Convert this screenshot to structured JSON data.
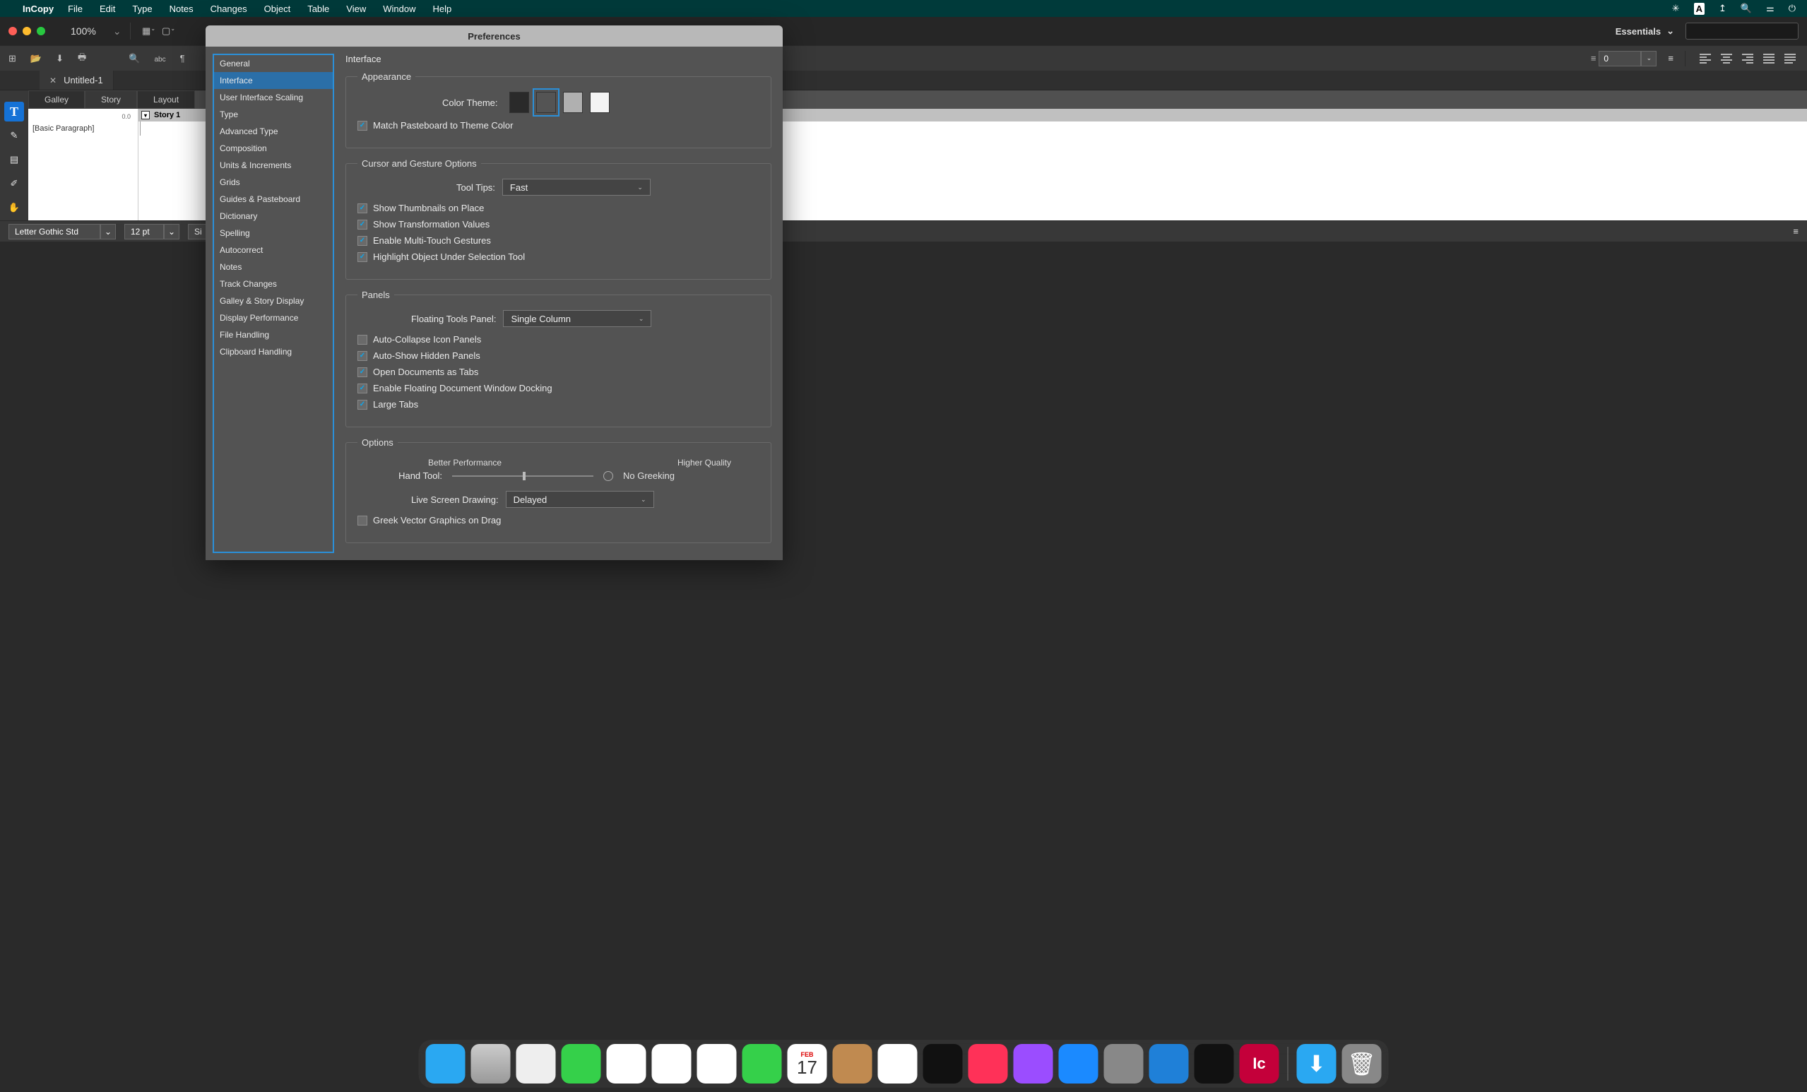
{
  "menubar": {
    "app": "InCopy",
    "items": [
      "File",
      "Edit",
      "Type",
      "Notes",
      "Changes",
      "Object",
      "Table",
      "View",
      "Window",
      "Help"
    ]
  },
  "titlebar": {
    "zoom": "100%",
    "workspace": "Essentials"
  },
  "doc_tabs": {
    "current": "Untitled-1"
  },
  "view_tabs": {
    "items": [
      "Galley",
      "Story",
      "Layout"
    ],
    "active": "Story"
  },
  "story": {
    "ruler_val": "0.0",
    "para_style": "[Basic Paragraph]",
    "story_label": "Story 1"
  },
  "statusbar": {
    "font": "Letter Gothic Std",
    "size": "12 pt",
    "third": "Si"
  },
  "num_field_right": "0",
  "preferences": {
    "title": "Preferences",
    "sidebar": [
      "General",
      "Interface",
      "User Interface Scaling",
      "Type",
      "Advanced Type",
      "Composition",
      "Units & Increments",
      "Grids",
      "Guides & Pasteboard",
      "Dictionary",
      "Spelling",
      "Autocorrect",
      "Notes",
      "Track Changes",
      "Galley & Story Display",
      "Display Performance",
      "File Handling",
      "Clipboard Handling"
    ],
    "sidebar_selected": "Interface",
    "heading": "Interface",
    "appearance": {
      "legend": "Appearance",
      "color_theme_label": "Color Theme:",
      "swatches": [
        "#2a2a2a",
        "#545454",
        "#b0b0b0",
        "#f4f4f4"
      ],
      "selected_swatch_index": 1,
      "match_pb": "Match Pasteboard to Theme Color"
    },
    "cursor": {
      "legend": "Cursor and Gesture Options",
      "tooltips_label": "Tool Tips:",
      "tooltips_value": "Fast",
      "checks": [
        "Show Thumbnails on Place",
        "Show Transformation Values",
        "Enable Multi-Touch Gestures",
        "Highlight Object Under Selection Tool"
      ]
    },
    "panels": {
      "legend": "Panels",
      "floating_label": "Floating Tools Panel:",
      "floating_value": "Single Column",
      "items": [
        {
          "label": "Auto-Collapse Icon Panels",
          "checked": false
        },
        {
          "label": "Auto-Show Hidden Panels",
          "checked": true
        },
        {
          "label": "Open Documents as Tabs",
          "checked": true
        },
        {
          "label": "Enable Floating Document Window Docking",
          "checked": true
        },
        {
          "label": "Large Tabs",
          "checked": true
        }
      ]
    },
    "options": {
      "legend": "Options",
      "better_perf": "Better Performance",
      "higher_q": "Higher Quality",
      "hand_tool": "Hand Tool:",
      "no_greek": "No Greeking",
      "lsd_label": "Live Screen Drawing:",
      "lsd_value": "Delayed",
      "greek_vector": "Greek Vector Graphics on Drag"
    }
  },
  "dock_items": [
    {
      "name": "finder",
      "bg": "#2aa8f2"
    },
    {
      "name": "launchpad",
      "bg": "linear-gradient(#ccc,#999)"
    },
    {
      "name": "safari",
      "bg": "#eee"
    },
    {
      "name": "messages",
      "bg": "#35d04a"
    },
    {
      "name": "mail",
      "bg": "#fff"
    },
    {
      "name": "maps",
      "bg": "#fff"
    },
    {
      "name": "photos",
      "bg": "#fff"
    },
    {
      "name": "facetime",
      "bg": "#35d04a"
    },
    {
      "name": "calendar",
      "bg": "#fff",
      "text": "17",
      "sub": "FEB"
    },
    {
      "name": "contacts",
      "bg": "#c08a50"
    },
    {
      "name": "notes",
      "bg": "#fff"
    },
    {
      "name": "appletv",
      "bg": "#111"
    },
    {
      "name": "music",
      "bg": "#ff3158"
    },
    {
      "name": "podcasts",
      "bg": "#9b4dff"
    },
    {
      "name": "appstore",
      "bg": "#1b8aff"
    },
    {
      "name": "settings",
      "bg": "#888"
    },
    {
      "name": "peak",
      "bg": "#1f80d8"
    },
    {
      "name": "terminal",
      "bg": "#111"
    },
    {
      "name": "incopy",
      "bg": "#c4003a",
      "text": "Ic"
    }
  ]
}
